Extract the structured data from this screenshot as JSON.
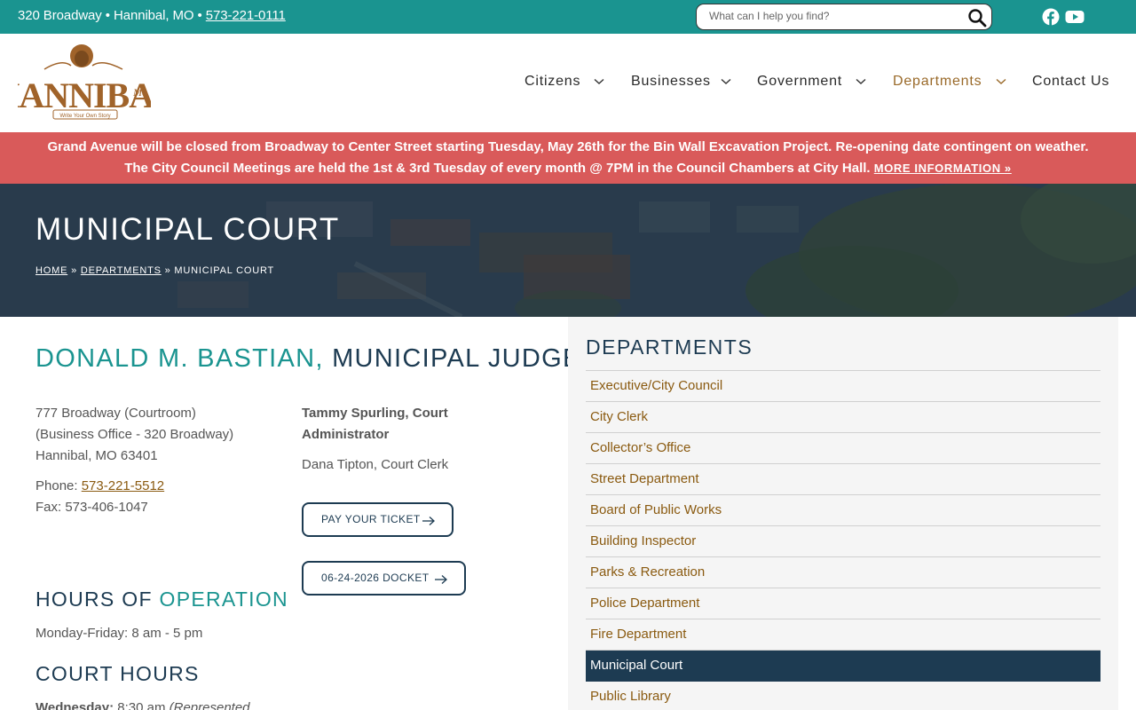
{
  "topbar": {
    "address": "320 Broadway • Hannibal, MO •",
    "phone": "573-221-0111",
    "search_placeholder": "What can I help you find?"
  },
  "nav": {
    "items": [
      {
        "label": "Citizens"
      },
      {
        "label": "Businesses"
      },
      {
        "label": "Government"
      },
      {
        "label": "Departments"
      },
      {
        "label": "Contact Us"
      }
    ]
  },
  "alert": {
    "line1": "Grand Avenue will be closed from Broadway to Center Street starting Tuesday, May 26th for the Bin Wall Excavation Project. Re-opening date contingent on weather.",
    "line2": "The City Council Meetings are held the 1st & 3rd Tuesday of every month @ 7PM in the Council Chambers at City Hall.",
    "more_link": "MORE INFORMATION »"
  },
  "hero": {
    "title": "MUNICIPAL COURT",
    "breadcrumb": {
      "home": "HOME",
      "sep": "»",
      "departments": "DEPARTMENTS",
      "current": "MUNICIPAL COURT"
    }
  },
  "content": {
    "judge_name": "DONALD M. BASTIAN,",
    "judge_title": "MUNICIPAL JUDGE",
    "address_line1": "777 Broadway (Courtroom)",
    "address_line2": "(Business Office - 320 Broadway)",
    "address_line3": "Hannibal, MO 63401",
    "phone_label": "Phone:",
    "phone": "573-221-5512",
    "fax": "Fax: 573-406-1047",
    "admin_line1": "Tammy Spurling, Court",
    "admin_line2": "Administrator",
    "clerk": "Dana Tipton, Court Clerk",
    "btn_ticket": "PAY YOUR TICKET",
    "btn_docket": "06-24-2026 DOCKET",
    "hours_heading_1": "HOURS OF",
    "hours_heading_2": "OPERATION",
    "hours": "Monday-Friday: 8 am - 5 pm",
    "court_hours_heading": "COURT HOURS",
    "court_day": "Wednesday:",
    "court_time": "8:30 am",
    "court_note": "(Represented"
  },
  "sidebar": {
    "title": "DEPARTMENTS",
    "items": [
      {
        "label": "Executive/City Council"
      },
      {
        "label": "City Clerk"
      },
      {
        "label": "Collector’s Office"
      },
      {
        "label": "Street Department"
      },
      {
        "label": "Board of Public Works"
      },
      {
        "label": "Building Inspector"
      },
      {
        "label": "Parks & Recreation"
      },
      {
        "label": "Police Department"
      },
      {
        "label": "Fire Department"
      },
      {
        "label": "Municipal Court"
      },
      {
        "label": "Public Library"
      }
    ],
    "active_index": 9
  },
  "colors": {
    "teal": "#1a9490",
    "navy": "#1d3b52",
    "alert_red": "#d95a5a",
    "link_brown": "#8a5a10"
  }
}
